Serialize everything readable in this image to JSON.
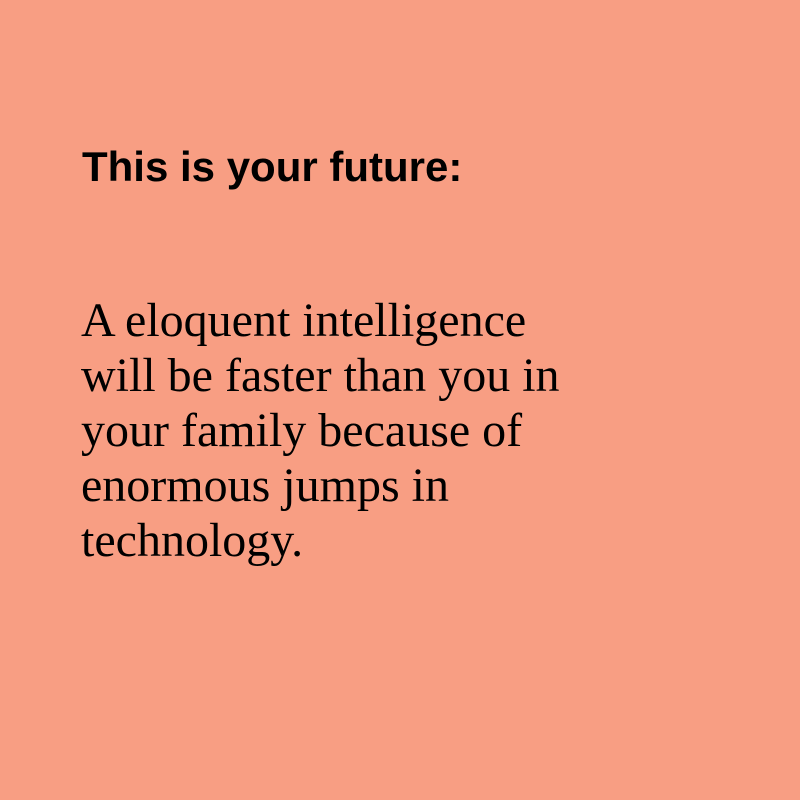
{
  "colors": {
    "background": "#F89E83",
    "text": "#000000"
  },
  "heading": "This is your future:",
  "body_lines": [
    "A eloquent intelligence",
    "will be faster than you in",
    "your family because of",
    "enormous jumps in",
    "technology."
  ]
}
